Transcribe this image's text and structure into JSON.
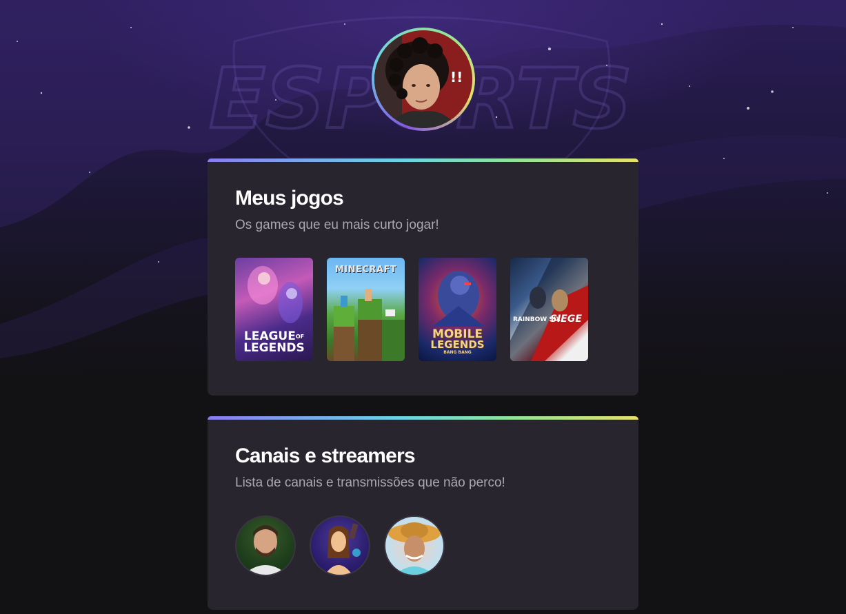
{
  "profile": {
    "avatar_icon": "profile-photo",
    "background_watermark": "ESPORTS"
  },
  "games_section": {
    "title": "Meus jogos",
    "subtitle": "Os games que eu mais curto jogar!",
    "games": [
      {
        "name": "league-of-legends",
        "line1": "LEAGUE",
        "line1b": "OF",
        "line2": "LEGENDS"
      },
      {
        "name": "minecraft",
        "line1": "MINECRAFT"
      },
      {
        "name": "mobile-legends",
        "line1": "MOBILE",
        "line2": "LEGENDS",
        "line3": "BANG BANG"
      },
      {
        "name": "rainbow-six-siege",
        "line1": "RAINBOW SIX",
        "line2": "SIEGE"
      }
    ]
  },
  "streamers_section": {
    "title": "Canais e streamers",
    "subtitle": "Lista de canais e transmissões que não perco!",
    "streamers": [
      {
        "name": "streamer-1"
      },
      {
        "name": "streamer-2"
      },
      {
        "name": "streamer-3"
      }
    ]
  },
  "colors": {
    "page_bg": "#121214",
    "card_bg": "#29252f",
    "text_primary": "#ffffff",
    "text_secondary": "#a8a8b3",
    "gradient": [
      "#8a7cf0",
      "#6ad4e5",
      "#8fe39a",
      "#e6e16a"
    ]
  }
}
